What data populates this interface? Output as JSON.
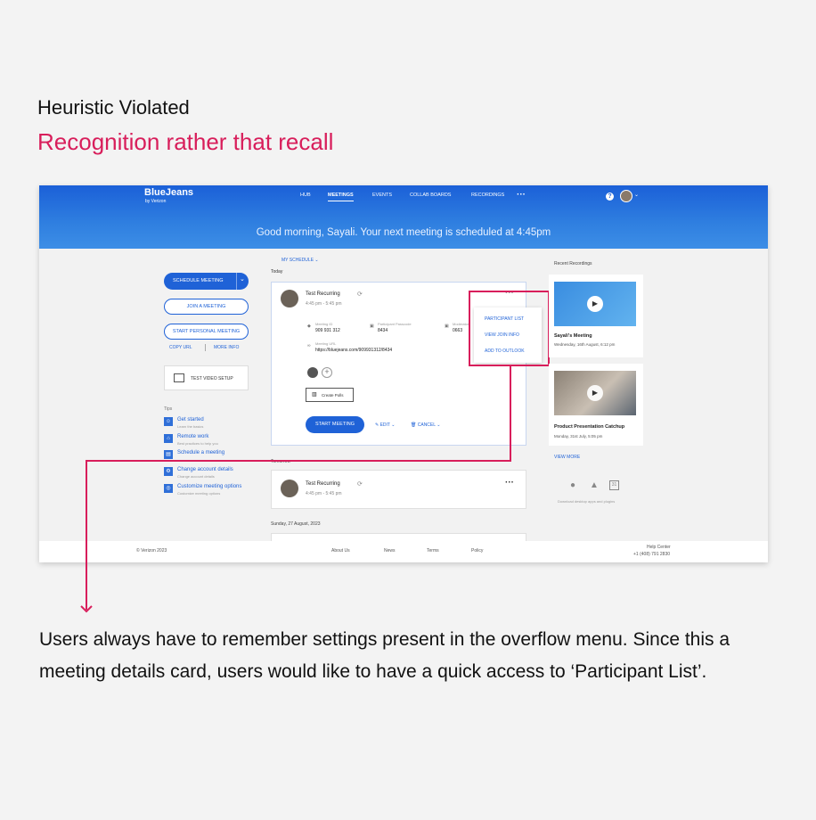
{
  "heading": {
    "title": "Heuristic Violated",
    "subtitle": "Recognition rather that recall"
  },
  "app": {
    "logo": "BlueJeans",
    "logo_sub": "by Verizon",
    "nav": [
      "HUB",
      "MEETINGS",
      "EVENTS",
      "COLLAB BOARDS",
      "RECORDINGS"
    ],
    "greeting": "Good morning, Sayali. Your next meeting is scheduled at 4:45pm",
    "sidebar": {
      "schedule": "SCHEDULE MEETING",
      "join": "JOIN A MEETING",
      "personal": "START PERSONAL MEETING",
      "copy_url": "COPY URL",
      "more_info": "MORE INFO",
      "test_video": "TEST VIDEO SETUP",
      "tips_label": "Tips",
      "tips": [
        {
          "title": "Get started",
          "desc": "Learn the basics"
        },
        {
          "title": "Remote work",
          "desc": "Best practices to help you"
        },
        {
          "title": "Schedule a meeting",
          "desc": ""
        },
        {
          "title": "Change account details",
          "desc": "Change account details"
        },
        {
          "title": "Customize meeting options",
          "desc": "Customize meeting options"
        }
      ]
    },
    "schedule": {
      "filter": "MY SCHEDULE",
      "today": "Today",
      "meeting1": {
        "title": "Test Recurring",
        "time": "4:45 pm - 5:45 pm",
        "id_label": "Meeting ID",
        "id_value": "909 931 312",
        "pass_label": "Participant Passcode",
        "pass_value": "8434",
        "mod_label": "Moderator",
        "mod_value": "0663",
        "url_label": "Meeting URL",
        "url_value": "https://bluejeans.com/909931312/8434",
        "polls": "Create Polls",
        "start": "START MEETING",
        "edit": "EDIT",
        "cancel": "CANCEL"
      },
      "overflow_menu": [
        "PARTICIPANT LIST",
        "VIEW JOIN INFO",
        "ADD TO OUTLOOK"
      ],
      "tomorrow": "Tomorrow",
      "meeting2": {
        "title": "Test Recurring",
        "time": "4:45 pm - 5:45 pm"
      },
      "sunday": "Sunday, 27 August, 2023"
    },
    "recordings": {
      "label": "Recent Recordings",
      "items": [
        {
          "title": "Sayali's Meeting",
          "date": "Wednesday, 16th August, 6:12 pm"
        },
        {
          "title": "Product Presentation Catchup",
          "date": "Monday, 31st July, 5:05 pm"
        }
      ],
      "view_more": "VIEW MORE",
      "download": "Download desktop apps and plugins"
    },
    "footer": {
      "copyright": "© Verizon 2023",
      "links": [
        "About Us",
        "News",
        "Terms",
        "Policy"
      ],
      "help": "Help Center",
      "phone": "+1 (408) 791 2830"
    }
  },
  "caption": "Users always have to remember settings present in the overflow menu. Since this a meeting details card, users would like to have a quick access to ‘Participant List’.",
  "colors": {
    "accent": "#d81e5b",
    "brand": "#1f62d7"
  }
}
